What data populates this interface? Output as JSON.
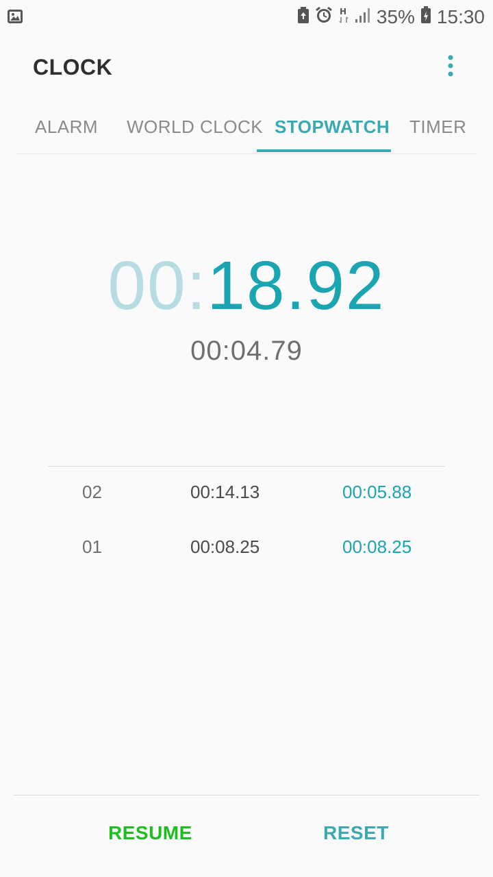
{
  "status_bar": {
    "battery_percent": "35%",
    "time": "15:30",
    "icons": [
      "image-icon",
      "battery-saver-icon",
      "alarm-icon",
      "h-network-icon",
      "signal-icon",
      "battery-charging-icon"
    ]
  },
  "app": {
    "title": "CLOCK",
    "menu_icon": "more-vert-icon"
  },
  "tabs": [
    {
      "label": "ALARM",
      "active": false
    },
    {
      "label": "WORLD CLOCK",
      "active": false
    },
    {
      "label": "STOPWATCH",
      "active": true
    },
    {
      "label": "TIMER",
      "active": false
    }
  ],
  "stopwatch": {
    "main_minutes": "00",
    "main_separator": ":",
    "main_seconds": "18.92",
    "current_lap": "00:04.79"
  },
  "laps": [
    {
      "number": "02",
      "time": "00:14.13",
      "split": "00:05.88"
    },
    {
      "number": "01",
      "time": "00:08.25",
      "split": "00:08.25"
    }
  ],
  "buttons": {
    "resume_label": "RESUME",
    "reset_label": "RESET"
  },
  "colors": {
    "accent": "#3aa9b2",
    "resume": "#1dbf1d",
    "time_light": "#b7dde2",
    "time_dark": "#1ba5b1"
  }
}
